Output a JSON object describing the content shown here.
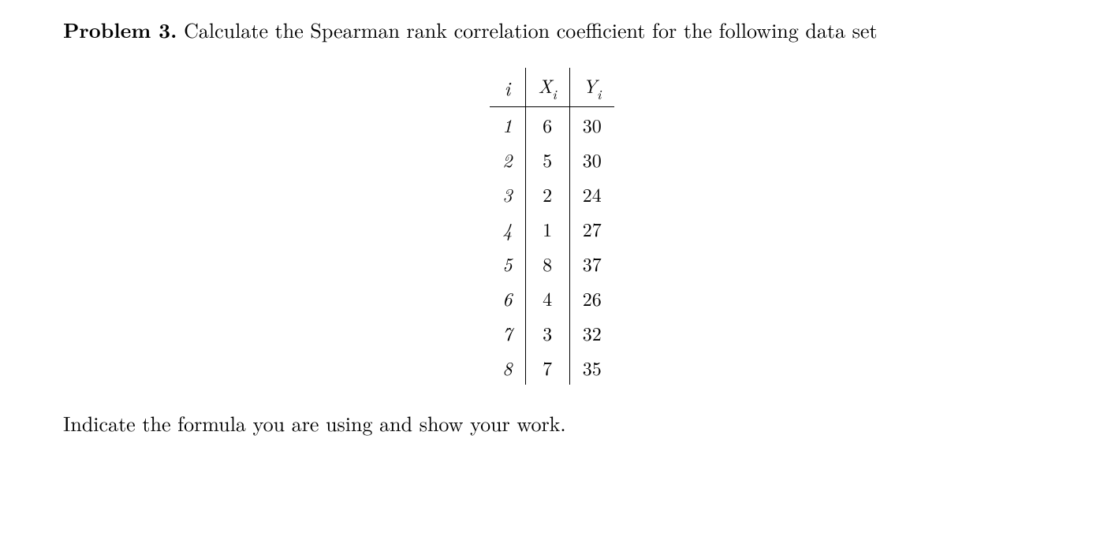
{
  "problem": {
    "label": "Problem 3.",
    "text": " Calculate the Spearman rank correlation coefficient for the following data set"
  },
  "table": {
    "headers": {
      "i": "i",
      "x_base": "X",
      "x_sub": "i",
      "y_base": "Y",
      "y_sub": "i"
    },
    "rows": [
      {
        "i": "1",
        "x": "6",
        "y": "30"
      },
      {
        "i": "2",
        "x": "5",
        "y": "30"
      },
      {
        "i": "3",
        "x": "2",
        "y": "24"
      },
      {
        "i": "4",
        "x": "1",
        "y": "27"
      },
      {
        "i": "5",
        "x": "8",
        "y": "37"
      },
      {
        "i": "6",
        "x": "4",
        "y": "26"
      },
      {
        "i": "7",
        "x": "3",
        "y": "32"
      },
      {
        "i": "8",
        "x": "7",
        "y": "35"
      }
    ]
  },
  "instruction": "Indicate the formula you are using and show your work."
}
